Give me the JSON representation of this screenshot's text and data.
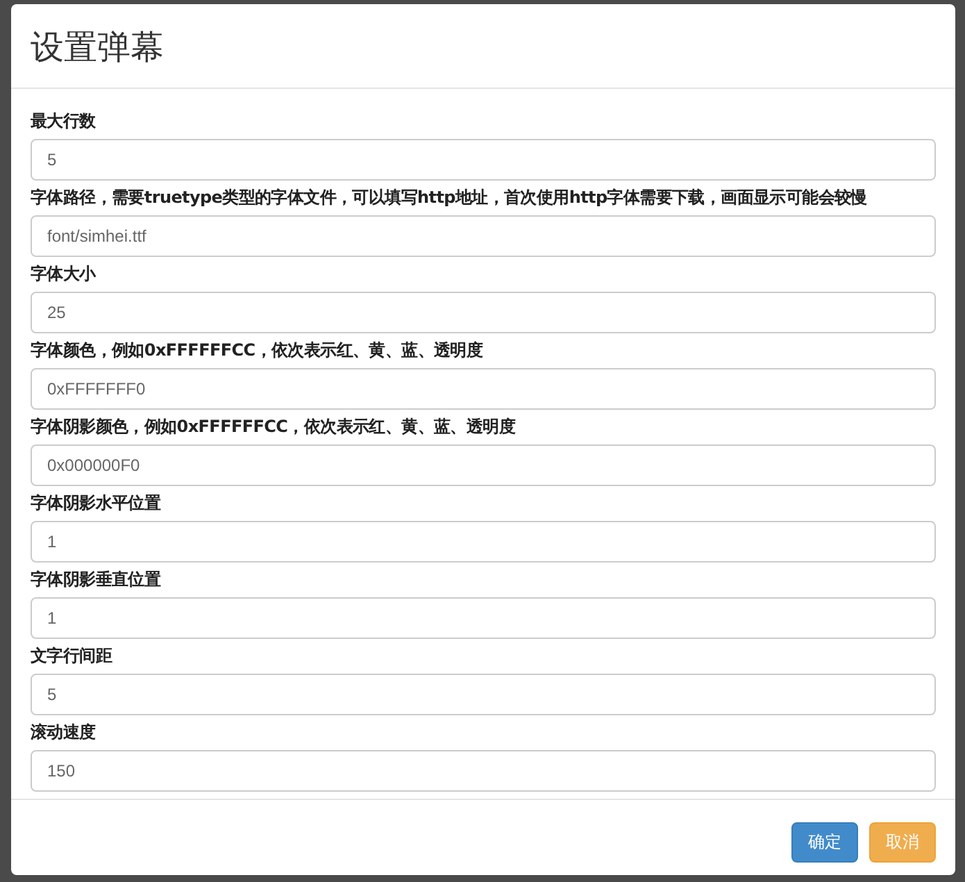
{
  "dialog": {
    "title": "设置弹幕"
  },
  "fields": [
    {
      "label": "最大行数",
      "value": "5"
    },
    {
      "label": "字体路径，需要truetype类型的字体文件，可以填写http地址，首次使用http字体需要下载，画面显示可能会较慢",
      "value": "font/simhei.ttf"
    },
    {
      "label": "字体大小",
      "value": "25"
    },
    {
      "label": "字体颜色，例如0xFFFFFFCC，依次表示红、黄、蓝、透明度",
      "value": "0xFFFFFFF0"
    },
    {
      "label": "字体阴影颜色，例如0xFFFFFFCC，依次表示红、黄、蓝、透明度",
      "value": "0x000000F0"
    },
    {
      "label": "字体阴影水平位置",
      "value": "1"
    },
    {
      "label": "字体阴影垂直位置",
      "value": "1"
    },
    {
      "label": "文字行间距",
      "value": "5"
    },
    {
      "label": "滚动速度",
      "value": "150"
    }
  ],
  "buttons": [
    {
      "label": "确定",
      "kind": "primary"
    },
    {
      "label": "取消",
      "kind": "warning"
    }
  ]
}
